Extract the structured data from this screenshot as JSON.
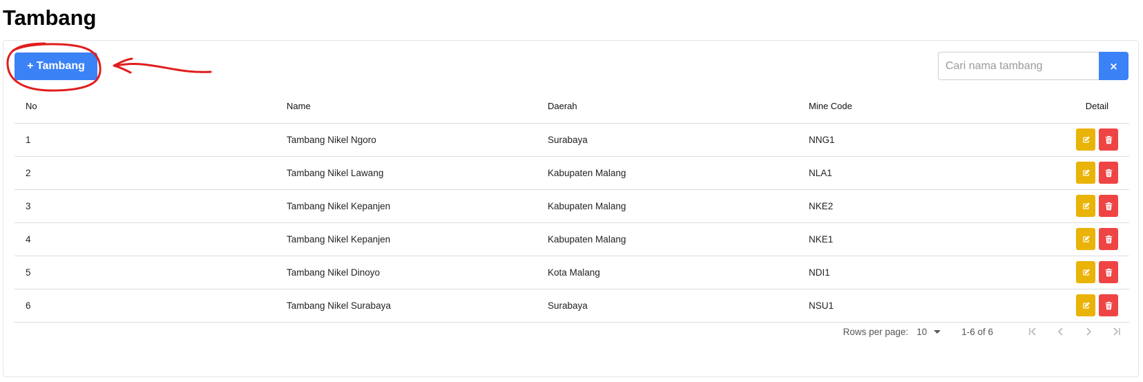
{
  "page": {
    "title": "Tambang"
  },
  "toolbar": {
    "add_label": "+ Tambang",
    "search_placeholder": "Cari nama tambang",
    "search_value": "",
    "clear_label": "×"
  },
  "table": {
    "headers": {
      "no": "No",
      "name": "Name",
      "daerah": "Daerah",
      "code": "Mine Code",
      "detail": "Detail"
    },
    "rows": [
      {
        "no": "1",
        "name": "Tambang Nikel Ngoro",
        "daerah": "Surabaya",
        "code": "NNG1"
      },
      {
        "no": "2",
        "name": "Tambang Nikel Lawang",
        "daerah": "Kabupaten Malang",
        "code": "NLA1"
      },
      {
        "no": "3",
        "name": "Tambang Nikel Kepanjen",
        "daerah": "Kabupaten Malang",
        "code": "NKE2"
      },
      {
        "no": "4",
        "name": "Tambang Nikel Kepanjen",
        "daerah": "Kabupaten Malang",
        "code": "NKE1"
      },
      {
        "no": "5",
        "name": "Tambang Nikel Dinoyo",
        "daerah": "Kota Malang",
        "code": "NDI1"
      },
      {
        "no": "6",
        "name": "Tambang Nikel Surabaya",
        "daerah": "Surabaya",
        "code": "NSU1"
      }
    ]
  },
  "pagination": {
    "rows_per_page_label": "Rows per page:",
    "rows_per_page_value": "10",
    "range_text": "1-6 of 6"
  },
  "colors": {
    "primary": "#3b82f6",
    "edit": "#eab308",
    "delete": "#ef4444",
    "annotation": "#e11d1d"
  },
  "icons": {
    "edit": "pencil-square-icon",
    "delete": "trash-icon",
    "first_page": "first-page-icon",
    "prev_page": "chevron-left-icon",
    "next_page": "chevron-right-icon",
    "last_page": "last-page-icon"
  }
}
